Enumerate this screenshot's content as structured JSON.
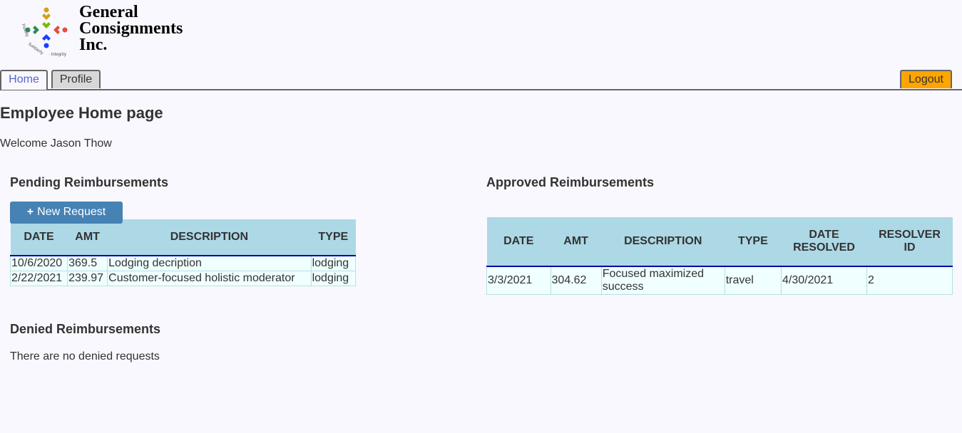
{
  "brand": {
    "name_line1": "General",
    "name_line2": "Consignments",
    "name_line3": "Inc.",
    "tagline": "Fidelity · Solidarity · Integrity",
    "colors": [
      "#d4a017",
      "#e74c3c",
      "#2e8b57",
      "#1e3cff",
      "#7cbb00"
    ]
  },
  "tabs": {
    "home": "Home",
    "profile": "Profile",
    "logout": "Logout"
  },
  "page": {
    "title": "Employee Home page",
    "welcome": "Welcome Jason Thow"
  },
  "pending": {
    "title": "Pending Reimbursements",
    "new_request_label": "New Request",
    "columns": [
      "DATE",
      "AMT",
      "DESCRIPTION",
      "TYPE"
    ],
    "rows": [
      [
        "10/6/2020",
        "369.5",
        "Lodging decription",
        "lodging"
      ],
      [
        "2/22/2021",
        "239.97",
        "Customer-focused holistic moderator",
        "lodging"
      ]
    ]
  },
  "approved": {
    "title": "Approved Reimbursements",
    "columns": [
      "DATE",
      "AMT",
      "DESCRIPTION",
      "TYPE",
      "DATE RESOLVED",
      "RESOLVER ID"
    ],
    "rows": [
      [
        "3/3/2021",
        "304.62",
        "Focused maximized success",
        "travel",
        "4/30/2021",
        "2"
      ]
    ]
  },
  "denied": {
    "title": "Denied Reimbursements",
    "empty_message": "There are no denied requests"
  }
}
